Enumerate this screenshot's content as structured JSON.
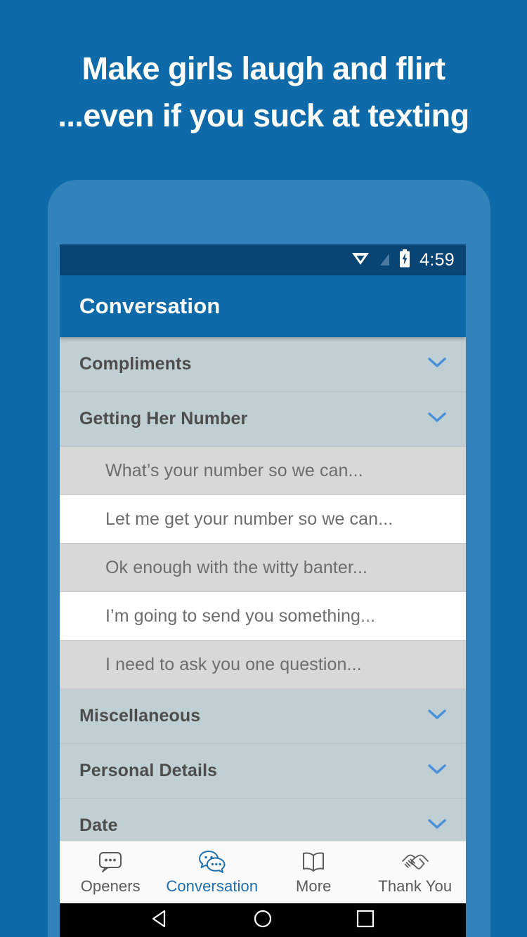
{
  "promo": {
    "line1": "Make girls laugh and flirt",
    "line2": "...even if you suck at texting"
  },
  "colors": {
    "background": "#0e6aa8",
    "frame": "#3283bb",
    "status_bar": "#0a4473",
    "app_bar": "#0e6aa8",
    "group_header": "#bfcfd4",
    "row_odd": "#d8d8d8",
    "row_even": "#ffffff",
    "accent": "#1f6fad",
    "chevron": "#4a90d9"
  },
  "status_bar": {
    "time": "4:59",
    "icons": [
      "wifi-icon",
      "signal-off-icon",
      "battery-charging-icon"
    ]
  },
  "app_bar": {
    "title": "Conversation"
  },
  "list": {
    "groups": [
      {
        "label": "Compliments",
        "expanded": false,
        "items": []
      },
      {
        "label": "Getting Her Number",
        "expanded": true,
        "items": [
          "What’s your number so we can...",
          "Let me get your number so we can...",
          "Ok enough with the witty banter...",
          "I’m going to send you something...",
          "I need to ask you one question..."
        ]
      },
      {
        "label": "Miscellaneous",
        "expanded": false,
        "items": []
      },
      {
        "label": "Personal Details",
        "expanded": false,
        "items": []
      },
      {
        "label": "Date",
        "expanded": false,
        "items": []
      }
    ]
  },
  "tab_bar": {
    "tabs": [
      {
        "label": "Openers",
        "icon": "speech-bubble-dots-icon",
        "active": false
      },
      {
        "label": "Conversation",
        "icon": "chat-bubbles-icon",
        "active": true
      },
      {
        "label": "More",
        "icon": "open-book-icon",
        "active": false
      },
      {
        "label": "Thank You",
        "icon": "handshake-icon",
        "active": false
      }
    ]
  },
  "nav_bar": {
    "buttons": [
      "back-icon",
      "home-icon",
      "recents-icon"
    ]
  }
}
